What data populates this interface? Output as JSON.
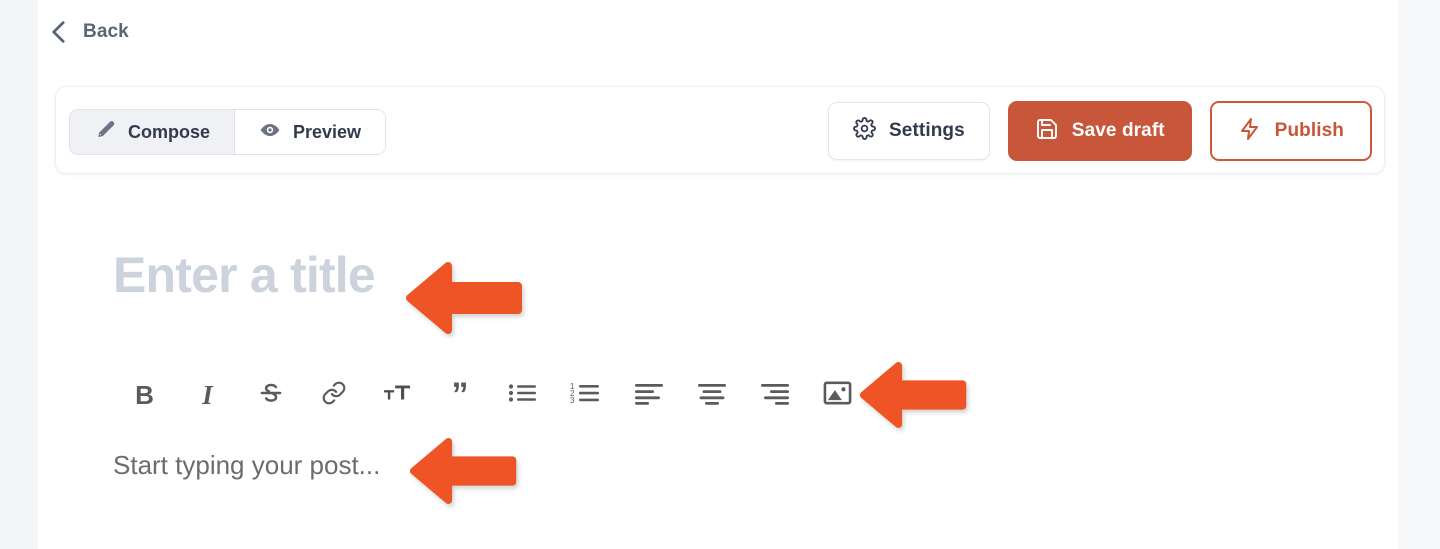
{
  "nav": {
    "back_label": "Back",
    "back_icon": "chevron-left-icon"
  },
  "toolbar": {
    "tabs": [
      {
        "label": "Compose",
        "icon": "pencil-icon",
        "active": true
      },
      {
        "label": "Preview",
        "icon": "eye-icon",
        "active": false
      }
    ],
    "actions": [
      {
        "label": "Settings",
        "icon": "gear-icon",
        "style": "secondary"
      },
      {
        "label": "Save draft",
        "icon": "floppy-disk-icon",
        "style": "primary"
      },
      {
        "label": "Publish",
        "icon": "lightning-bolt-icon",
        "style": "outline"
      }
    ]
  },
  "editor": {
    "title_placeholder": "Enter a title",
    "body_placeholder": "Start typing your post...",
    "format_buttons": [
      {
        "name": "bold",
        "icon": "bold-icon",
        "glyph": "B"
      },
      {
        "name": "italic",
        "icon": "italic-icon",
        "glyph": "I"
      },
      {
        "name": "strikethrough",
        "icon": "strikethrough-icon",
        "glyph": "S"
      },
      {
        "name": "link",
        "icon": "link-icon",
        "glyph": ""
      },
      {
        "name": "text-size",
        "icon": "text-size-icon",
        "glyph": "tT"
      },
      {
        "name": "quote",
        "icon": "quote-icon",
        "glyph": "”"
      },
      {
        "name": "bullet-list",
        "icon": "bullet-list-icon",
        "glyph": ""
      },
      {
        "name": "numbered-list",
        "icon": "numbered-list-icon",
        "glyph": ""
      },
      {
        "name": "align-left",
        "icon": "align-left-icon",
        "glyph": ""
      },
      {
        "name": "align-center",
        "icon": "align-center-icon",
        "glyph": ""
      },
      {
        "name": "align-right",
        "icon": "align-right-icon",
        "glyph": ""
      },
      {
        "name": "insert-image",
        "icon": "image-icon",
        "glyph": ""
      }
    ]
  },
  "annotations": {
    "arrow_color": "#ef5427",
    "arrows": [
      {
        "target": "title-placeholder"
      },
      {
        "target": "insert-image-button"
      },
      {
        "target": "body-placeholder"
      }
    ]
  },
  "colors": {
    "accent_orange": "#c8563a",
    "arrow_orange": "#ef5427",
    "text_dark": "#333a4d",
    "text_muted": "#5c6478",
    "placeholder_title": "#ccd3dd",
    "placeholder_body": "#6c6c6c"
  }
}
